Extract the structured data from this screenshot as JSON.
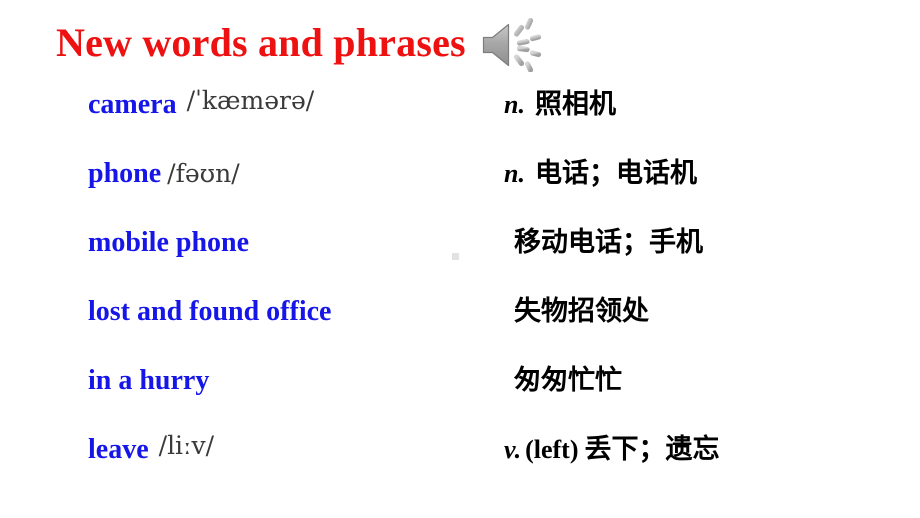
{
  "slide": {
    "title": "New words and phrases",
    "title_color": "#ee1111",
    "term_color": "#1616e8",
    "phonetic_color": "#3a3a3a",
    "definition_color": "#000000",
    "background": "#ffffff",
    "audio_icon": "speaker-icon"
  },
  "entries": [
    {
      "term": "camera",
      "phonetic": "/ˈkæmərə/",
      "pos": "n.",
      "paren": "",
      "meaning": "照相机"
    },
    {
      "term": "phone",
      "phonetic": "/fəʊn/",
      "pos": "n.",
      "paren": "",
      "meaning": "电话；电话机"
    },
    {
      "term": "mobile phone",
      "phonetic": "",
      "pos": "",
      "paren": "",
      "meaning": "移动电话；手机"
    },
    {
      "term": "lost and found office",
      "phonetic": "",
      "pos": "",
      "paren": "",
      "meaning": "失物招领处"
    },
    {
      "term": "in a hurry",
      "phonetic": "",
      "pos": "",
      "paren": "",
      "meaning": "匆匆忙忙"
    },
    {
      "term": "leave",
      "phonetic": "/liːv/",
      "pos": "v.",
      "paren": "(left)",
      "meaning": "丢下；遗忘"
    }
  ]
}
